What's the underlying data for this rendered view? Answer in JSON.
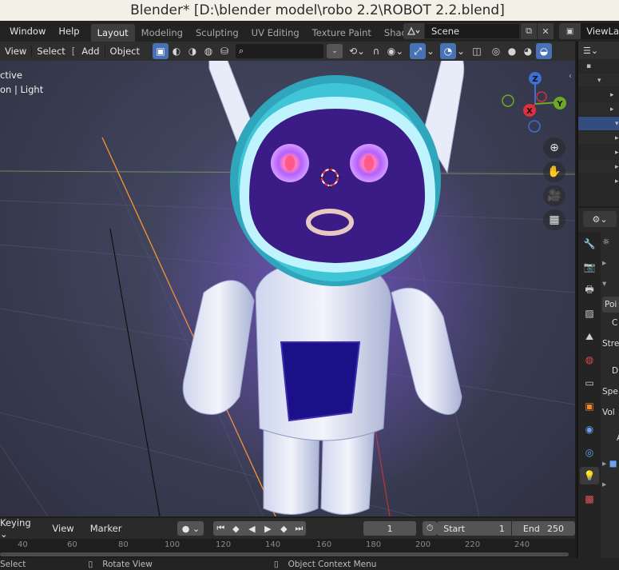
{
  "window": {
    "title": "Blender* [D:\\blender model\\robo 2.2\\ROBOT 2.2.blend]"
  },
  "menu": {
    "items": [
      "Window",
      "Help"
    ]
  },
  "workspace_tabs": [
    "Layout",
    "Modeling",
    "Sculpting",
    "UV Editing",
    "Texture Paint",
    "Shadi"
  ],
  "scene": {
    "name": "Scene",
    "view_layer": "ViewLa"
  },
  "viewport_header": {
    "view": "View",
    "select": "Select",
    "add": "Add",
    "object": "Object",
    "bracket": "["
  },
  "viewport": {
    "mode_label_1": "ctive",
    "mode_label_2": "on | Light",
    "gizmo": {
      "z": "Z",
      "y": "Y",
      "x": "X"
    }
  },
  "properties": {
    "rows": [
      "Poi",
      "C",
      "Stre",
      "Di",
      "Spe",
      "Vol",
      "A"
    ]
  },
  "timeline": {
    "keying": "Keying",
    "view": "View",
    "marker": "Marker",
    "current_frame": "1",
    "start_label": "Start",
    "start_value": "1",
    "end_label": "End",
    "end_value": "250",
    "ruler": [
      "40",
      "60",
      "80",
      "100",
      "120",
      "140",
      "160",
      "180",
      "200",
      "220",
      "240"
    ]
  },
  "status": {
    "left": "Select",
    "middle": "Rotate View",
    "right": "Object Context Menu"
  },
  "colors": {
    "accent": "#4772b3",
    "helmet": "#3fc5d6",
    "glow": "#8a55ff"
  }
}
